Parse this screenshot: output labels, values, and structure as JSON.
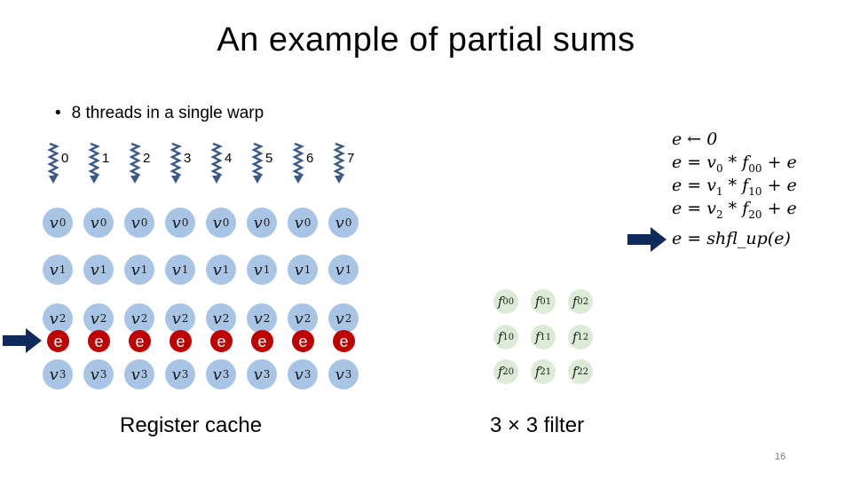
{
  "slide": {
    "title": "An example of partial sums",
    "bullet": "8 threads in a single warp",
    "page_number": "16"
  },
  "threads": [
    "0",
    "1",
    "2",
    "3",
    "4",
    "5",
    "6",
    "7"
  ],
  "register_cache": {
    "caption": "Register cache",
    "rows": [
      {
        "var": "v",
        "sub": "0"
      },
      {
        "var": "v",
        "sub": "1"
      },
      {
        "var": "v",
        "sub": "2"
      },
      {
        "var": "v",
        "sub": "3"
      }
    ],
    "accumulator_label": "e",
    "circle_color": "#a9c5e6",
    "accumulator_color": "#c00000"
  },
  "filter": {
    "caption": "3 × 3 filter",
    "cells": [
      [
        "00",
        "01",
        "02"
      ],
      [
        "10",
        "11",
        "12"
      ],
      [
        "20",
        "21",
        "22"
      ]
    ],
    "var": "f",
    "circle_color": "#dcebd6"
  },
  "code": {
    "lines": [
      {
        "lhs": "e",
        "op": "←",
        "rhs": "0"
      },
      {
        "lhs": "e",
        "op": "=",
        "rhs": "v0 * f00 + e"
      },
      {
        "lhs": "e",
        "op": "=",
        "rhs": "v1 * f10 + e"
      },
      {
        "lhs": "e",
        "op": "=",
        "rhs": "v2 * f20 + e"
      },
      {
        "lhs": "e",
        "op": "=",
        "rhs": "shfl_up(e)"
      }
    ],
    "current_line": 4,
    "arrow_color": "#0e2a5c"
  }
}
